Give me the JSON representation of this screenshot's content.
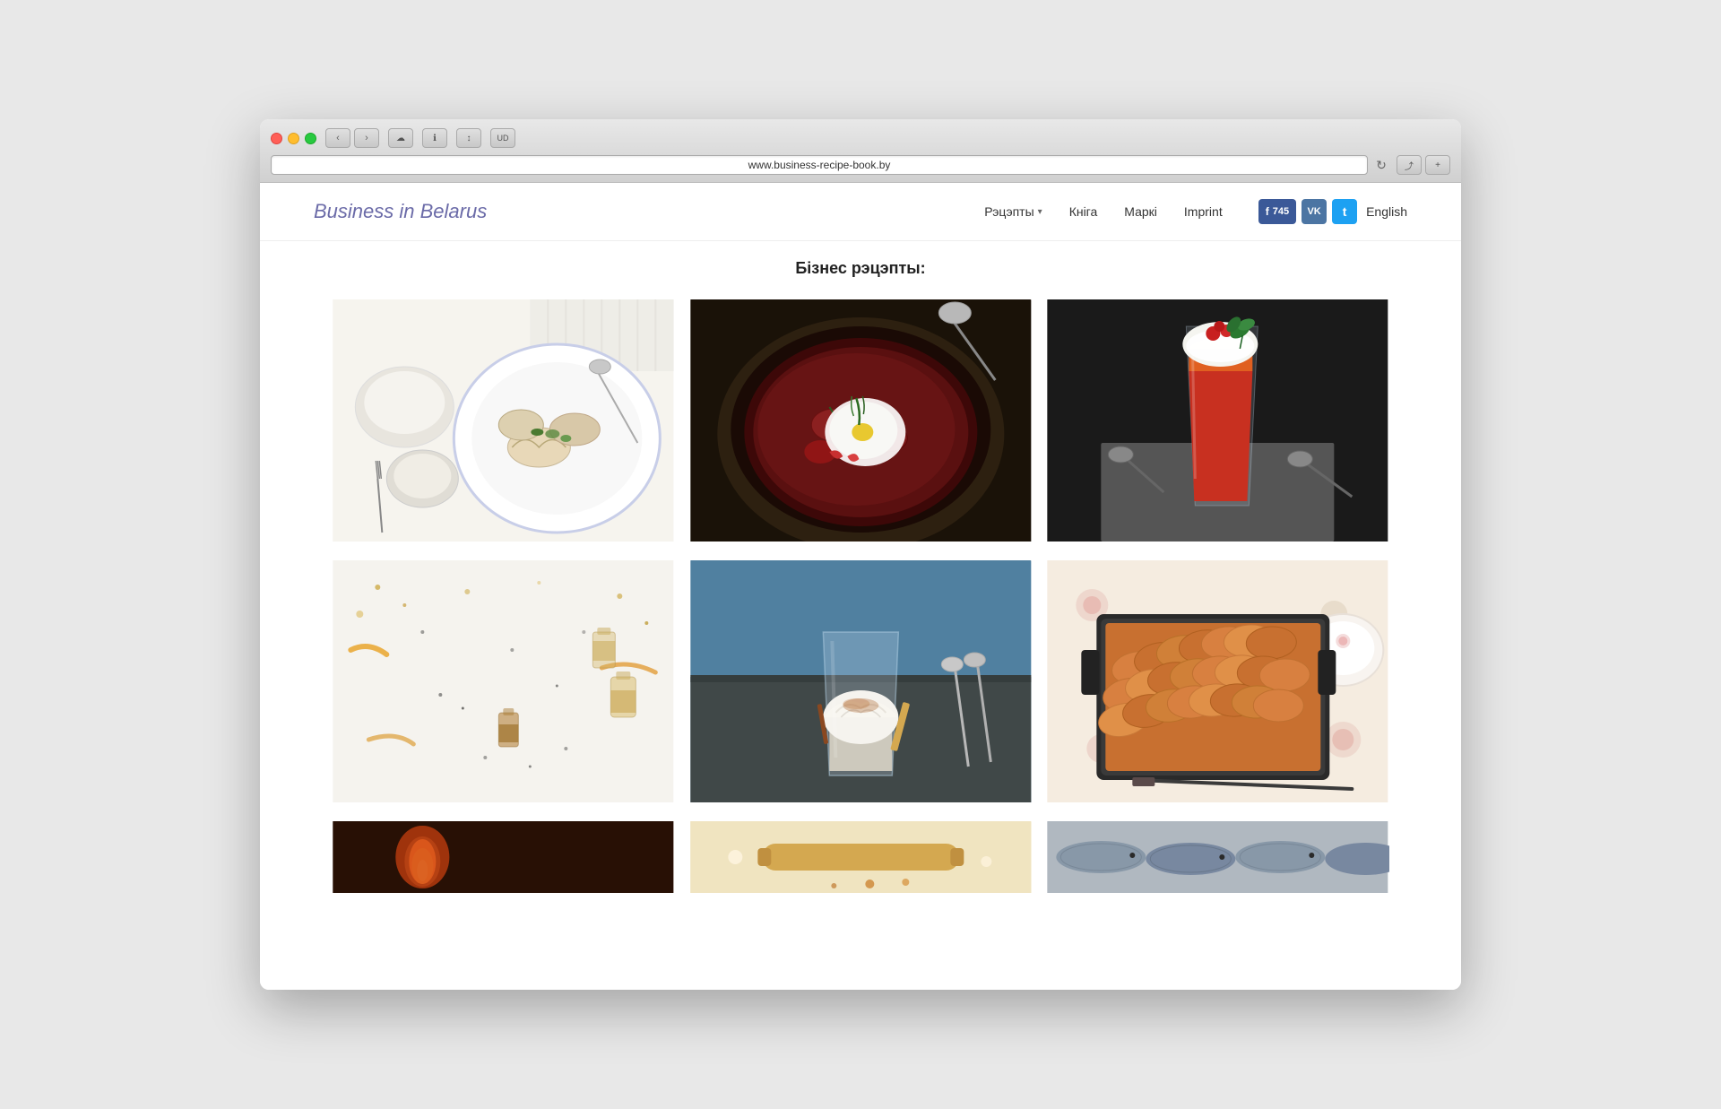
{
  "browser": {
    "url": "www.business-recipe-book.by",
    "nav": {
      "back": "‹",
      "forward": "›"
    }
  },
  "header": {
    "logo": "Business in Belarus",
    "nav_items": [
      {
        "label": "Рэцэпты",
        "has_dropdown": true
      },
      {
        "label": "Кніга"
      },
      {
        "label": "Маркі"
      },
      {
        "label": "Imprint"
      }
    ],
    "social": {
      "facebook_label": "f",
      "facebook_count": "745",
      "vk_label": "VK",
      "twitter_label": "t"
    },
    "language": "English"
  },
  "main": {
    "page_title": "Бізнес рэцэпты:",
    "recipes": [
      {
        "id": 1,
        "alt": "Dumplings dish on white plate",
        "color_scheme": "light"
      },
      {
        "id": 2,
        "alt": "Dark borscht soup with poached egg",
        "color_scheme": "dark"
      },
      {
        "id": 3,
        "alt": "Red tomato cocktail drink with cream and berries",
        "color_scheme": "dark"
      },
      {
        "id": 4,
        "alt": "Small glass bottles with golden liquid and spices",
        "color_scheme": "light"
      },
      {
        "id": 5,
        "alt": "Whipped cream dessert in glass",
        "color_scheme": "medium"
      },
      {
        "id": 6,
        "alt": "Baked potato gratin in roasting pan",
        "color_scheme": "light-warm"
      },
      {
        "id": 7,
        "alt": "Candle or fire dish",
        "color_scheme": "dark-warm",
        "partial": true
      },
      {
        "id": 8,
        "alt": "Baked goods with rolling pin",
        "color_scheme": "warm",
        "partial": true
      },
      {
        "id": 9,
        "alt": "Fish dish",
        "color_scheme": "cool",
        "partial": true
      }
    ]
  }
}
